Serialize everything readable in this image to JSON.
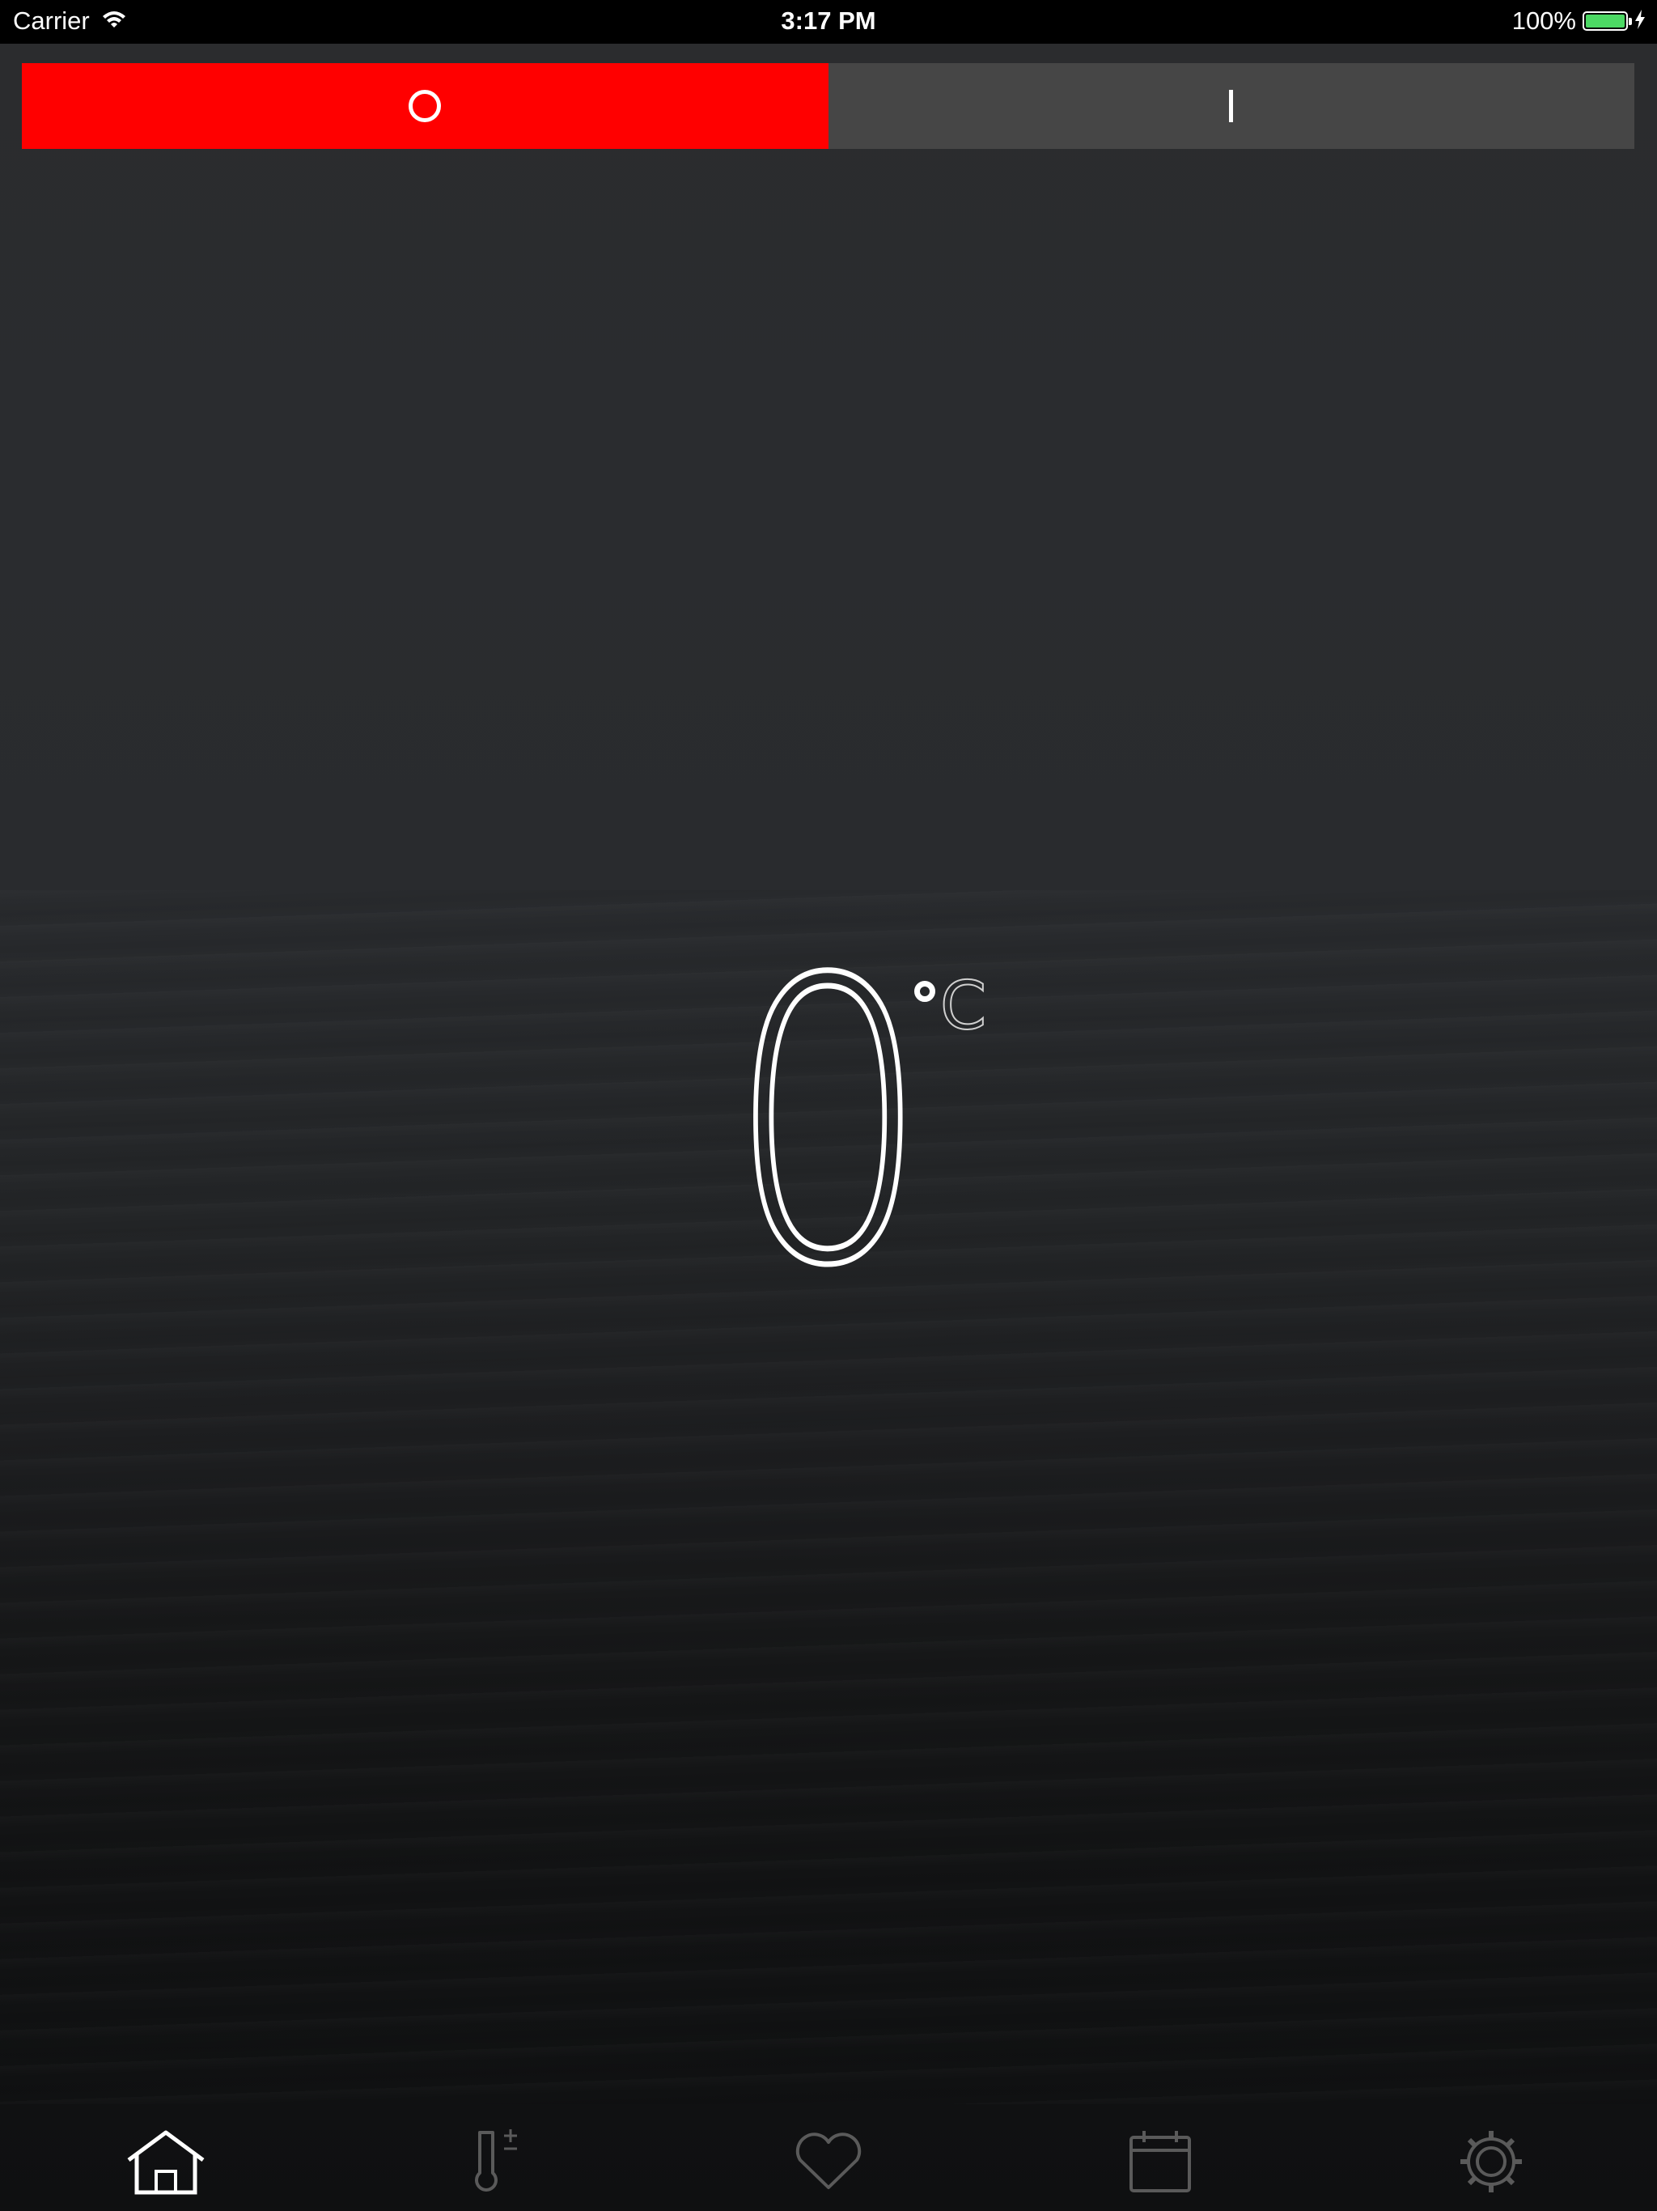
{
  "status_bar": {
    "carrier": "Carrier",
    "time": "3:17 PM",
    "battery_percent": "100%",
    "wifi_icon": "wifi-icon",
    "battery_icon": "battery-icon",
    "charging_icon": "lightning-icon",
    "battery_level": 1.0,
    "battery_color": "#4cd964"
  },
  "power_toggle": {
    "segments": [
      {
        "icon": "power-off-icon",
        "selected": true,
        "color": "#ff0000"
      },
      {
        "icon": "power-on-icon",
        "selected": false,
        "color": "#464646"
      }
    ]
  },
  "temperature": {
    "value": "0",
    "unit": "C",
    "degree_icon": "degree-icon"
  },
  "tab_bar": {
    "items": [
      {
        "icon": "home-icon",
        "active": true
      },
      {
        "icon": "thermometer-adjust-icon",
        "active": false
      },
      {
        "icon": "heart-icon",
        "active": false
      },
      {
        "icon": "calendar-icon",
        "active": false
      },
      {
        "icon": "gear-icon",
        "active": false
      }
    ],
    "active_color": "#ffffff",
    "inactive_color": "#5a5a5a"
  }
}
